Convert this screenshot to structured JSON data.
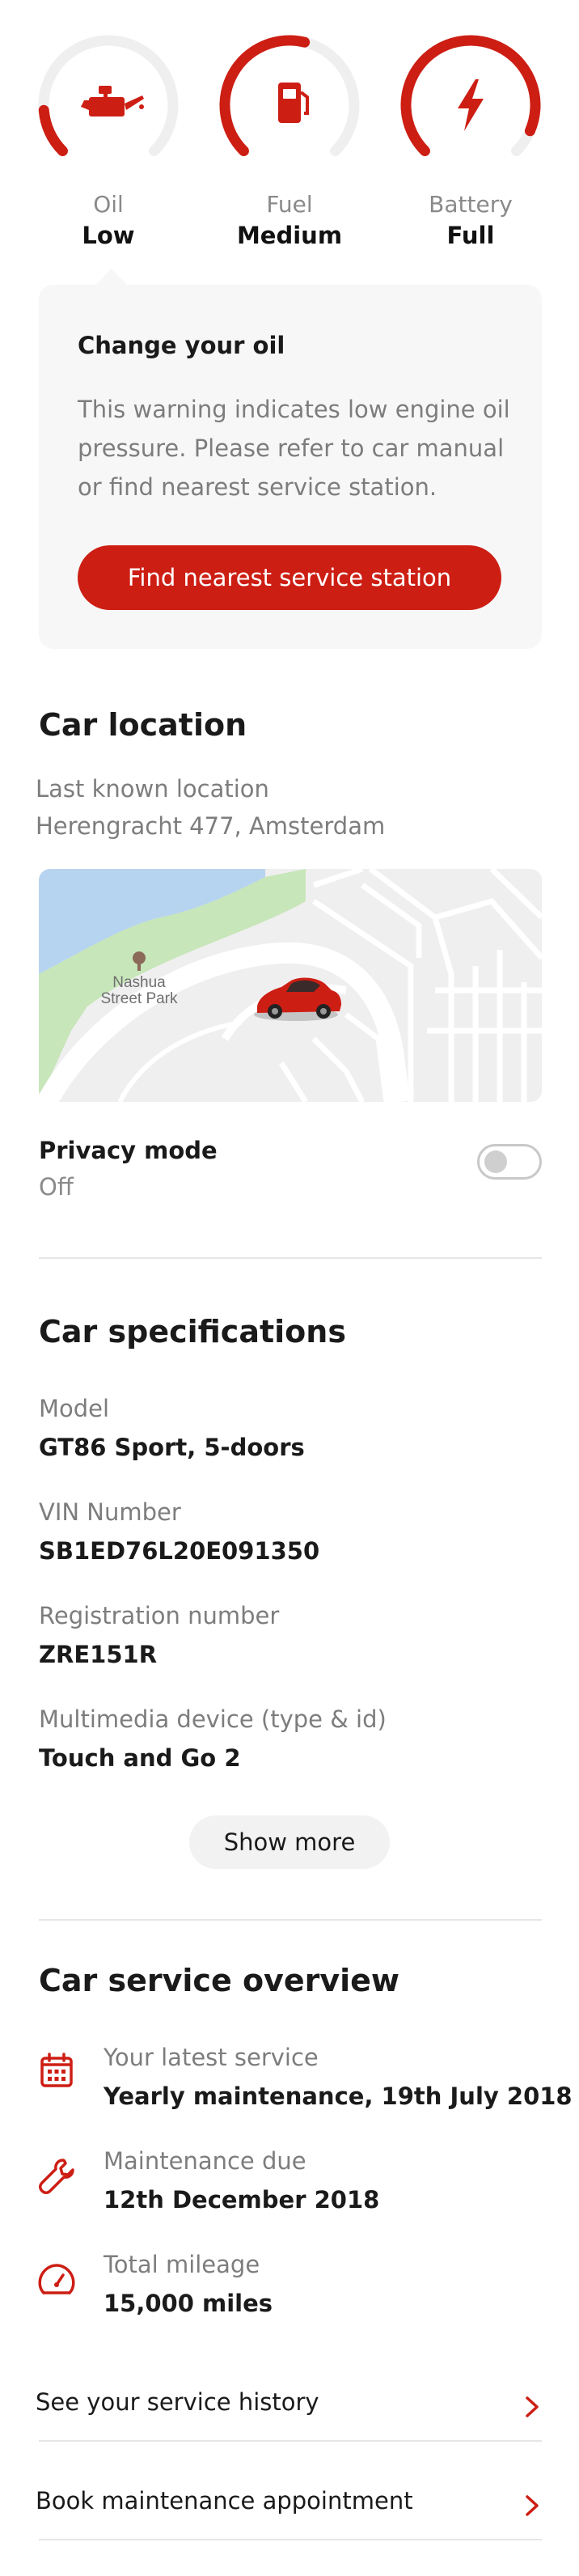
{
  "colors": {
    "accent": "#cd1e14",
    "muted": "#7d7d7d",
    "track": "#efefef"
  },
  "gauges": [
    {
      "name": "Oil",
      "value": "Low",
      "icon": "oil-can-icon",
      "level": 0.15
    },
    {
      "name": "Fuel",
      "value": "Medium",
      "icon": "fuel-pump-icon",
      "level": 0.55
    },
    {
      "name": "Battery",
      "value": "Full",
      "icon": "lightning-icon",
      "level": 0.92
    }
  ],
  "warning": {
    "title": "Change your oil",
    "body": "This warning indicates low engine oil pressure. Please refer to car manual or find nearest service station.",
    "button": "Find nearest service station"
  },
  "location": {
    "title": "Car location",
    "subtitle": "Last known location",
    "address": "Herengracht 477, Amsterdam",
    "map_label_line1": "Nashua",
    "map_label_line2": "Street Park",
    "privacy_title": "Privacy mode",
    "privacy_value": "Off",
    "privacy_enabled": false
  },
  "specs": {
    "title": "Car specifications",
    "items": [
      {
        "label": "Model",
        "value": "GT86 Sport, 5-doors"
      },
      {
        "label": "VIN Number",
        "value": "SB1ED76L20E091350"
      },
      {
        "label": "Registration number",
        "value": "ZRE151R"
      },
      {
        "label": "Multimedia device (type & id)",
        "value": "Touch and Go 2"
      }
    ],
    "more_button": "Show more"
  },
  "service": {
    "title": "Car service overview",
    "items": [
      {
        "label": "Your latest service",
        "value": "Yearly maintenance, 19th July 2018",
        "icon": "calendar-icon"
      },
      {
        "label": "Maintenance due",
        "value": "12th December 2018",
        "icon": "wrench-icon"
      },
      {
        "label": "Total mileage",
        "value": "15,000 miles",
        "icon": "speedometer-icon"
      }
    ],
    "links": [
      {
        "label": "See your service history",
        "icon": "chevron-right-icon"
      },
      {
        "label": "Book maintenance appointment",
        "icon": "chevron-right-icon"
      }
    ]
  }
}
